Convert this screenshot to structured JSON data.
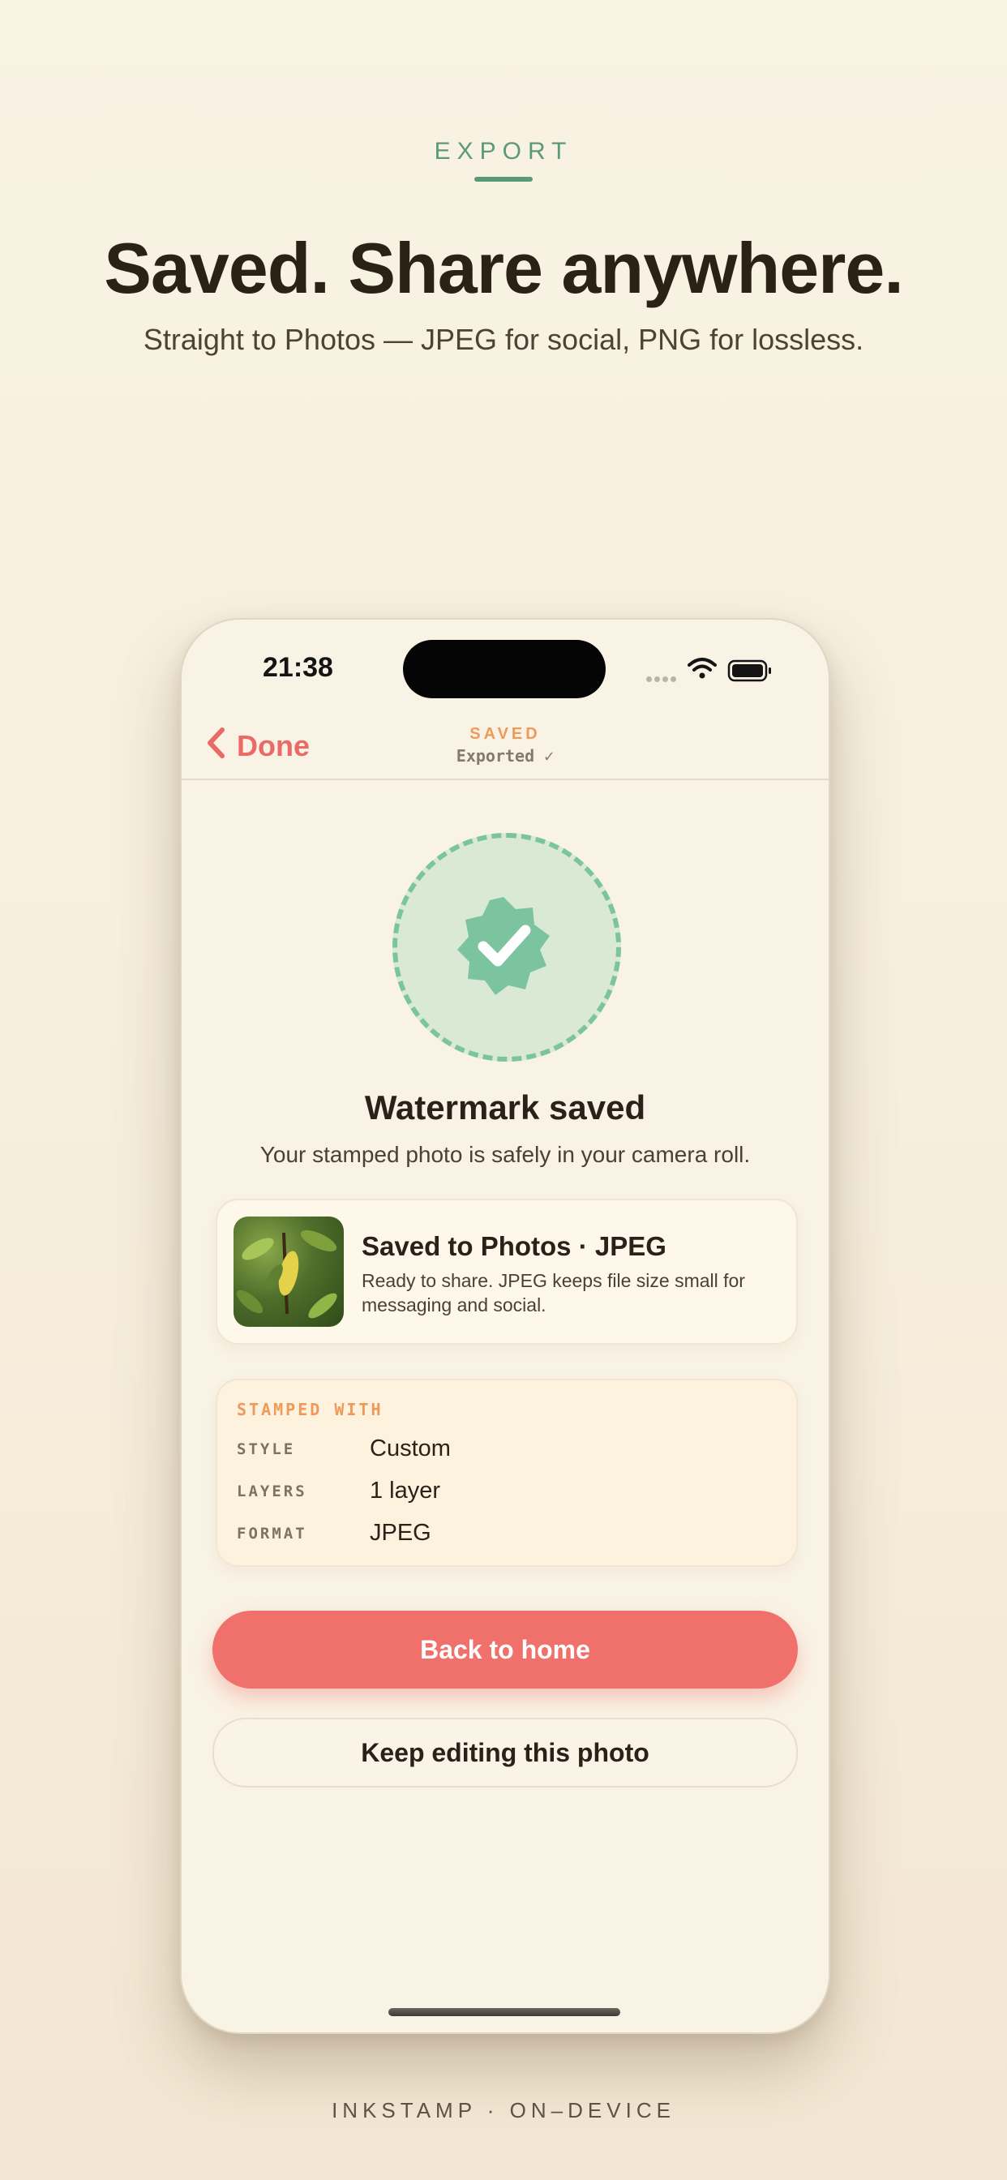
{
  "header": {
    "eyebrow": "EXPORT",
    "headline": "Saved. Share anywhere.",
    "subhead": "Straight to Photos — JPEG for social, PNG for lossless."
  },
  "status_bar": {
    "time": "21:38"
  },
  "nav": {
    "back_label": "Done",
    "title": "SAVED",
    "subtitle": "Exported ✓"
  },
  "success": {
    "title": "Watermark saved",
    "description": "Your stamped photo is safely in your camera roll."
  },
  "photo_card": {
    "title": "Saved to Photos · JPEG",
    "description": "Ready to share. JPEG keeps file size small for messaging and social."
  },
  "stamp_card": {
    "heading": "STAMPED WITH",
    "rows": [
      {
        "key": "STYLE",
        "value": "Custom"
      },
      {
        "key": "LAYERS",
        "value": "1 layer"
      },
      {
        "key": "FORMAT",
        "value": "JPEG"
      }
    ]
  },
  "actions": {
    "primary": "Back to home",
    "secondary": "Keep editing this photo"
  },
  "footer": {
    "text": "INKSTAMP · ON–DEVICE"
  },
  "colors": {
    "accent": "#f0716c",
    "success": "#7cc4a0",
    "eyebrow": "#5b9a78",
    "highlight": "#ef9a5a"
  },
  "icons": [
    "chevron-left-icon",
    "wifi-icon",
    "battery-icon",
    "check-badge-icon"
  ]
}
